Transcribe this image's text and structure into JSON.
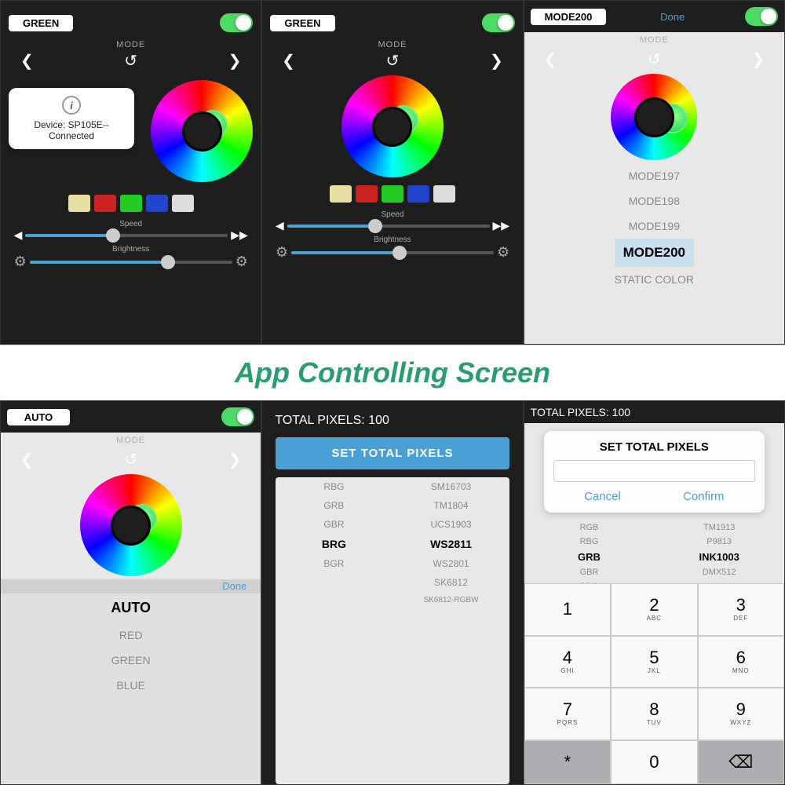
{
  "title": "App Controlling Screen",
  "panels": {
    "top_left": {
      "mode": "GREEN",
      "mode_label": "MODE",
      "toggle_on": true,
      "info_device": "Device: SP105E--",
      "info_status": "Connected",
      "swatches": [
        "#e8e0a0",
        "#cc2222",
        "#22cc22",
        "#2244cc",
        "#dddddd"
      ]
    },
    "top_center": {
      "mode": "GREEN",
      "mode_label": "MODE",
      "toggle_on": true,
      "swatches": [
        "#e8e0a0",
        "#cc2222",
        "#22cc22",
        "#2244cc",
        "#dddddd"
      ]
    },
    "top_right": {
      "mode": "MODE200",
      "mode_label": "MODE",
      "toggle_on": true,
      "done_label": "Done",
      "mode_list": [
        "MODE197",
        "MODE198",
        "MODE199",
        "MODE200",
        "STATIC COLOR"
      ]
    },
    "bottom_left": {
      "mode": "AUTO",
      "mode_label": "MODE",
      "toggle_on": true,
      "done_label": "Done",
      "mode_list": [
        "AUTO",
        "RED",
        "GREEN",
        "BLUE"
      ]
    },
    "bottom_center": {
      "total_pixels_label": "TOTAL PIXELS: 100",
      "set_button": "SET TOTAL PIXELS",
      "protocols_left": [
        "RBG",
        "GRB",
        "GBR",
        "BRG",
        "BGR",
        "",
        ""
      ],
      "protocols_right": [
        "SM16703",
        "TM1804",
        "UCS1903",
        "WS2811",
        "WS2801",
        "SK6812",
        "SK6812-RGBW"
      ],
      "selected_left": "BRG",
      "selected_right": "WS2811"
    },
    "bottom_right": {
      "total_pixels_label": "TOTAL PIXELS: 100",
      "dialog_title": "SET TOTAL PIXELS",
      "cancel_label": "Cancel",
      "confirm_label": "Confirm",
      "protocols_left": [
        "RGB",
        "RBG",
        "GRB",
        "GBR",
        "BRG"
      ],
      "protocols_right": [
        "TM1913",
        "P9813",
        "INK1003",
        "DMX512",
        ""
      ],
      "selected_left": "GRB",
      "selected_right": "INK1003",
      "numpad": [
        {
          "number": "1",
          "letters": ""
        },
        {
          "number": "2",
          "letters": "ABC"
        },
        {
          "number": "3",
          "letters": "DEF"
        },
        {
          "number": "4",
          "letters": "GHI"
        },
        {
          "number": "5",
          "letters": "JKL"
        },
        {
          "number": "6",
          "letters": "MNO"
        },
        {
          "number": "7",
          "letters": "PQRS"
        },
        {
          "number": "8",
          "letters": "TUV"
        },
        {
          "number": "9",
          "letters": "WXYZ"
        },
        {
          "number": "0",
          "letters": ""
        }
      ]
    }
  },
  "speed_label": "Speed",
  "brightness_label": "Brightness"
}
